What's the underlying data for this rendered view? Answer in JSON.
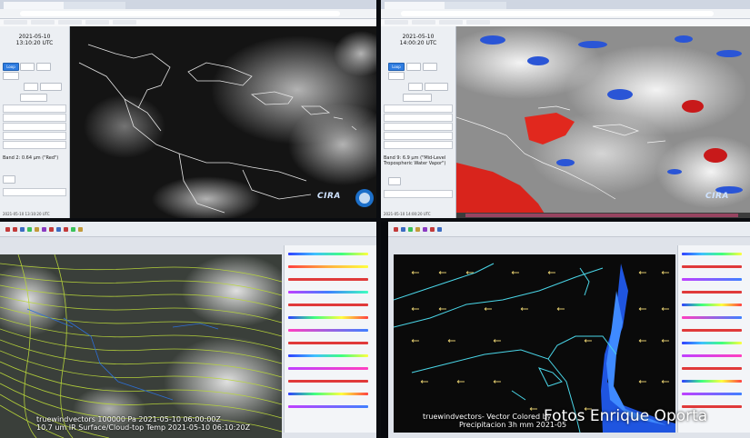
{
  "screens": {
    "top_left": {
      "date": "2021-05-10",
      "time": "13:10:20 UTC",
      "loop_label": "Loop",
      "band": "Band 2: 0.64 µm (\"Red\")",
      "bottom_timestamp": "2021-05-10 13:10:20 UTC",
      "logo": "CIRA"
    },
    "top_right": {
      "date": "2021-05-10",
      "time": "14:00:20 UTC",
      "loop_label": "Loop",
      "band": "Band 9: 6.9 µm (\"Mid-Level Tropospheric Water Vapor\")",
      "bottom_timestamp": "2021-05-10 14:00:20 UTC",
      "logo": "CIRA"
    },
    "bottom_left": {
      "title_line1": "truewindvectors 100000 Pa 2021-05-10 06:00:00Z",
      "title_line2": "10.7 um IR Surface/Cloud-top Temp 2021-05-10 06:10:20Z"
    },
    "bottom_right": {
      "title_line1": "truewindvectors- Vector Colored by",
      "title_line2": "Precipitacion 3h mm 2021-05"
    }
  },
  "watermark": "Fotos Enrique Oporta"
}
